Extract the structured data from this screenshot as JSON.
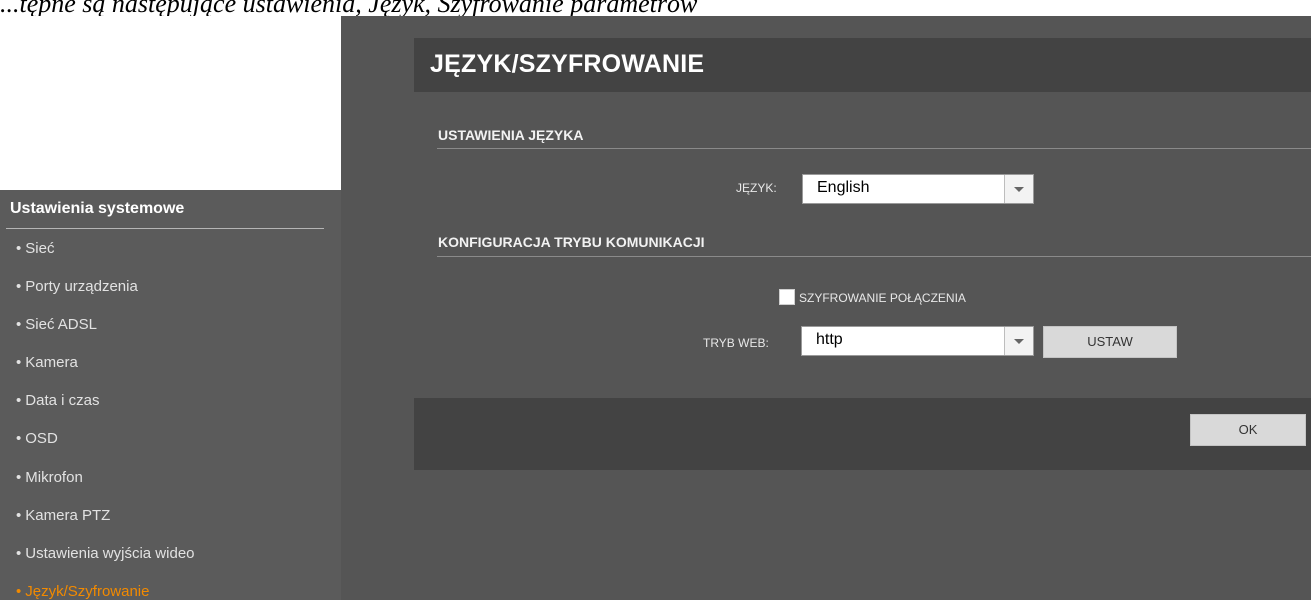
{
  "caption": "...tępne są następujące ustawienia, Język, Szyfrowanie parametrów",
  "sidebar": {
    "title": "Ustawienia systemowe",
    "bullet": "•",
    "items": [
      {
        "label": "Sieć"
      },
      {
        "label": "Porty urządzenia"
      },
      {
        "label": "Sieć ADSL"
      },
      {
        "label": "Kamera"
      },
      {
        "label": "Data i czas"
      },
      {
        "label": "OSD"
      },
      {
        "label": "Mikrofon"
      },
      {
        "label": "Kamera PTZ"
      },
      {
        "label": "Ustawienia wyjścia wideo"
      },
      {
        "label": "Język/Szyfrowanie",
        "active": true
      }
    ]
  },
  "header": {
    "title": "JĘZYK/SZYFROWANIE"
  },
  "language_section": {
    "title": "USTAWIENIA JĘZYKA",
    "field_label": "JĘZYK:",
    "selected": "English"
  },
  "comm_section": {
    "title": "KONFIGURACJA TRYBU KOMUNIKACJI",
    "checkbox_label": "SZYFROWANIE POŁĄCZENIA",
    "checkbox_checked": false,
    "web_mode_label": "TRYB WEB:",
    "web_mode_selected": "http",
    "set_button": "USTAW"
  },
  "footer": {
    "ok_button": "OK"
  },
  "colors": {
    "accent_active": "#f28a00",
    "main_bg": "#555555",
    "header_bg": "#434343",
    "sidebar_bg": "#5b5b5b"
  }
}
